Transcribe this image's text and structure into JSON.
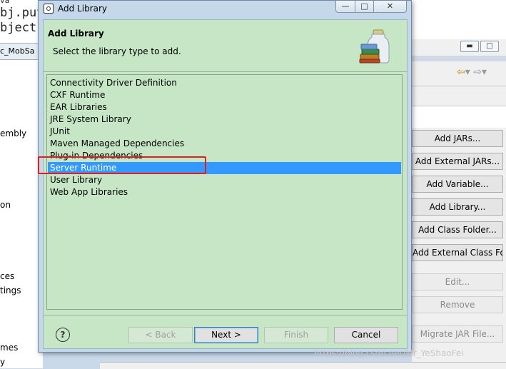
{
  "background": {
    "code_lines": [
      "va",
      "bj.put",
      "bject"
    ],
    "tab_label": "c_MobSa",
    "left_fragments": [
      "embly",
      "on",
      "ces",
      "tings",
      "mes",
      "y"
    ],
    "nav_arrows": [
      "⇦",
      "▾",
      "⇨",
      "▾"
    ],
    "side_buttons": [
      {
        "label": "Add JARs...",
        "enabled": true
      },
      {
        "label": "Add External JARs...",
        "enabled": true
      },
      {
        "label": "Add Variable...",
        "enabled": true
      },
      {
        "label": "Add Library...",
        "enabled": true
      },
      {
        "label": "Add Class Folder...",
        "enabled": true
      },
      {
        "label": "Add External Class Folde",
        "enabled": true
      },
      {
        "label": "Edit...",
        "enabled": false
      },
      {
        "label": "Remove",
        "enabled": false
      },
      {
        "label": "Migrate JAR File...",
        "enabled": false
      }
    ],
    "watermark": "https://blog.csdn.net/Mr_YeShaoFei"
  },
  "dialog": {
    "window_title": "Add Library",
    "header_title": "Add Library",
    "header_description": "Select the library type to add.",
    "library_types": [
      "Connectivity Driver Definition",
      "CXF Runtime",
      "EAR Libraries",
      "JRE System Library",
      "JUnit",
      "Maven Managed Dependencies",
      "Plug-in Dependencies",
      "Server Runtime",
      "User Library",
      "Web App Libraries"
    ],
    "selected_library": "Server Runtime",
    "help_label": "?",
    "buttons": {
      "back": "< Back",
      "next": "Next >",
      "finish": "Finish",
      "cancel": "Cancel"
    },
    "accent_selection_color": "#3399ff",
    "highlight_color": "#e02020"
  }
}
